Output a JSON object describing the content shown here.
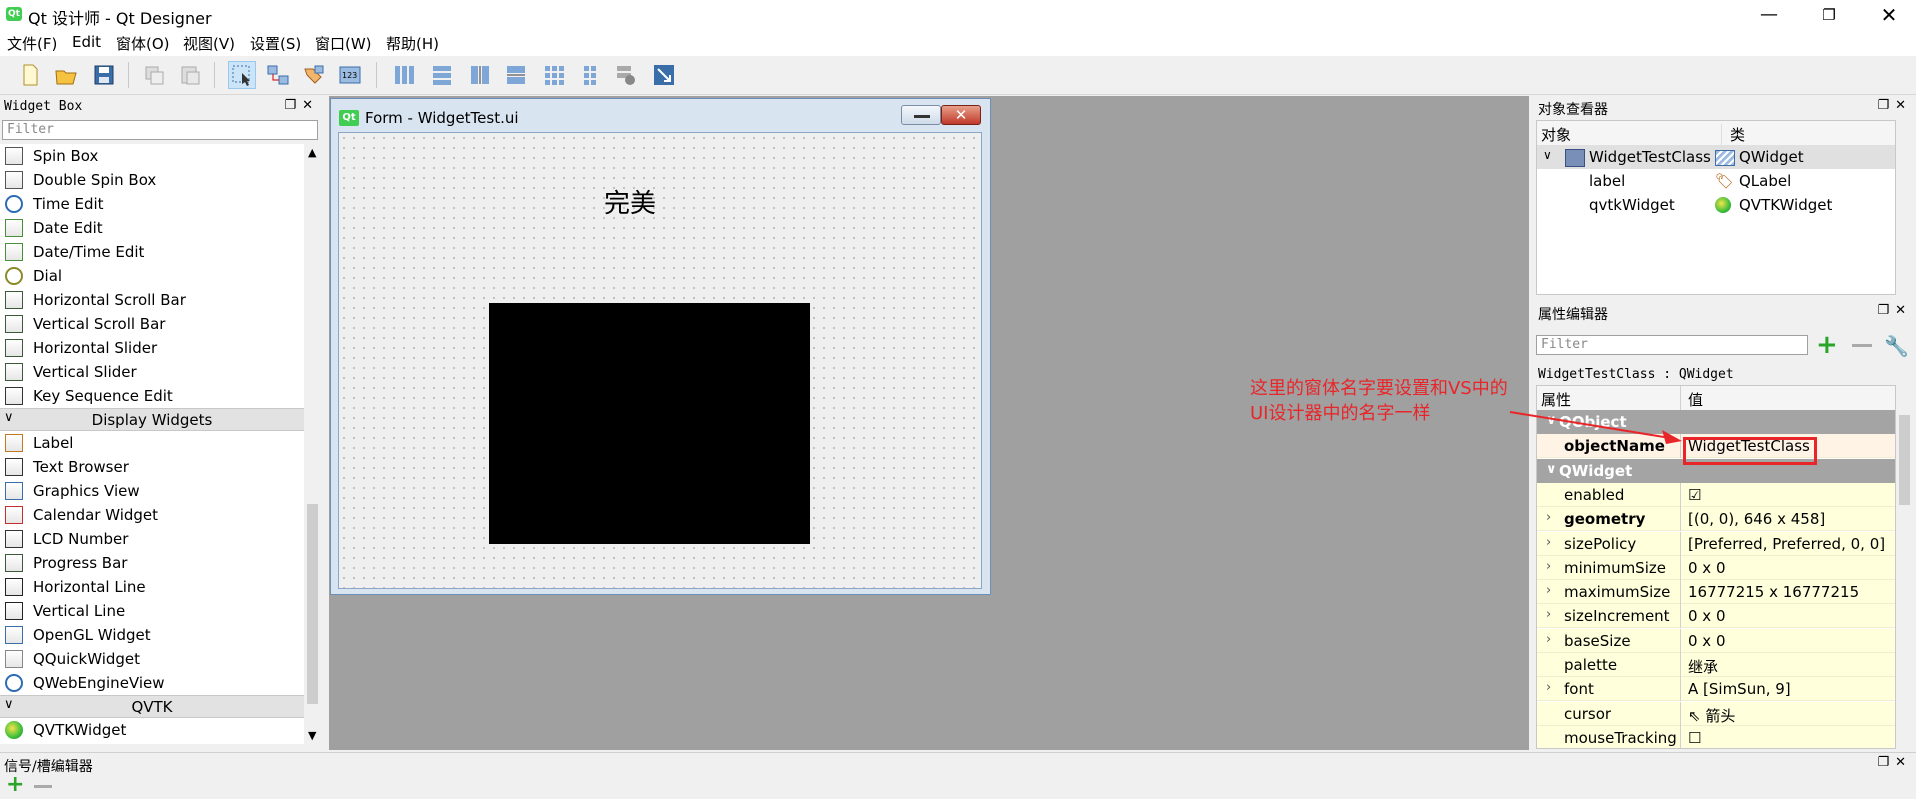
{
  "window": {
    "title": "Qt 设计师 - Qt Designer",
    "icon_label": "Qt",
    "controls": [
      "minimize-icon",
      "maximize-icon",
      "close-icon"
    ]
  },
  "menubar": [
    "文件(F)",
    "Edit",
    "窗体(O)",
    "视图(V)",
    "设置(S)",
    "窗口(W)",
    "帮助(H)"
  ],
  "toolbar": {
    "buttons": [
      "new-file-icon",
      "open-file-icon",
      "save-icon",
      "copy-icon",
      "paste-icon",
      "edit-widgets-icon",
      "edit-signals-icon",
      "edit-buddies-icon",
      "edit-tab-order-icon",
      "layout-horizontal-icon",
      "layout-vertical-icon",
      "splitter-horizontal-icon",
      "splitter-vertical-icon",
      "layout-grid-icon",
      "layout-form-icon",
      "break-layout-icon",
      "adjust-size-icon"
    ]
  },
  "widget_box": {
    "title": "Widget Box",
    "filter_placeholder": "Filter",
    "items_top": [
      {
        "label": "Spin Box",
        "icon": "spin-box-icon"
      },
      {
        "label": "Double Spin Box",
        "icon": "double-spin-box-icon"
      },
      {
        "label": "Time Edit",
        "icon": "clock-icon"
      },
      {
        "label": "Date Edit",
        "icon": "calendar-icon"
      },
      {
        "label": "Date/Time Edit",
        "icon": "calendar-clock-icon"
      },
      {
        "label": "Dial",
        "icon": "dial-icon"
      },
      {
        "label": "Horizontal Scroll Bar",
        "icon": "hscroll-icon"
      },
      {
        "label": "Vertical Scroll Bar",
        "icon": "vscroll-icon"
      },
      {
        "label": "Horizontal Slider",
        "icon": "hslider-icon"
      },
      {
        "label": "Vertical Slider",
        "icon": "vslider-icon"
      },
      {
        "label": "Key Sequence Edit",
        "icon": "keyseq-icon"
      }
    ],
    "category_display": "Display Widgets",
    "items_display": [
      {
        "label": "Label",
        "icon": "label-tag-icon"
      },
      {
        "label": "Text Browser",
        "icon": "text-browser-icon"
      },
      {
        "label": "Graphics View",
        "icon": "graphics-view-icon"
      },
      {
        "label": "Calendar Widget",
        "icon": "calendar-widget-icon"
      },
      {
        "label": "LCD Number",
        "icon": "lcd-icon"
      },
      {
        "label": "Progress Bar",
        "icon": "progress-bar-icon"
      },
      {
        "label": "Horizontal Line",
        "icon": "hline-icon"
      },
      {
        "label": "Vertical Line",
        "icon": "vline-icon"
      },
      {
        "label": "OpenGL Widget",
        "icon": "opengl-icon"
      },
      {
        "label": "QQuickWidget",
        "icon": "qquick-icon"
      },
      {
        "label": "QWebEngineView",
        "icon": "globe-icon"
      }
    ],
    "category_qvtk": "QVTK",
    "items_qvtk": [
      {
        "label": "QVTKWidget",
        "icon": "qvtk-icon"
      }
    ]
  },
  "form": {
    "title": "Form - WidgetTest.ui",
    "label_text": "完美"
  },
  "object_inspector": {
    "title": "对象查看器",
    "col_object": "对象",
    "col_class": "类",
    "rows": [
      {
        "object": "WidgetTestClass",
        "class": "QWidget"
      },
      {
        "object": "label",
        "class": "QLabel"
      },
      {
        "object": "qvtkWidget",
        "class": "QVTKWidget"
      }
    ]
  },
  "property_editor": {
    "title": "属性编辑器",
    "filter_placeholder": "Filter",
    "class_line": "WidgetTestClass : QWidget",
    "col_property": "属性",
    "col_value": "值",
    "rows": [
      {
        "name": "QObject",
        "value": "",
        "group": true
      },
      {
        "name": "objectName",
        "value": "WidgetTestClass",
        "bold": true,
        "exp": false
      },
      {
        "name": "QWidget",
        "value": "",
        "group": true
      },
      {
        "name": "enabled",
        "value": "☑",
        "exp": false
      },
      {
        "name": "geometry",
        "value": "[(0, 0), 646 x 458]",
        "bold": true,
        "exp": true
      },
      {
        "name": "sizePolicy",
        "value": "[Preferred, Preferred, 0, 0]",
        "exp": true
      },
      {
        "name": "minimumSize",
        "value": "0 x 0",
        "exp": true
      },
      {
        "name": "maximumSize",
        "value": "16777215 x 16777215",
        "exp": true
      },
      {
        "name": "sizeIncrement",
        "value": "0 x 0",
        "exp": true
      },
      {
        "name": "baseSize",
        "value": "0 x 0",
        "exp": true
      },
      {
        "name": "palette",
        "value": "继承",
        "exp": false
      },
      {
        "name": "font",
        "value": "A  [SimSun, 9]",
        "exp": true
      },
      {
        "name": "cursor",
        "value": "⇖  箭头",
        "exp": false
      },
      {
        "name": "mouseTracking",
        "value": "☐",
        "exp": false
      }
    ]
  },
  "signal_editor": {
    "title": "信号/槽编辑器"
  },
  "annotation": {
    "line1": "这里的窗体名字要设置和VS中的",
    "line2": "UI设计器中的名字一样"
  },
  "colors": {
    "accent_red": "#e8262a",
    "group_gray": "#a4a4a4",
    "highlight_yellow": "#ffffdc",
    "selected_row": "#e0e0e0"
  }
}
